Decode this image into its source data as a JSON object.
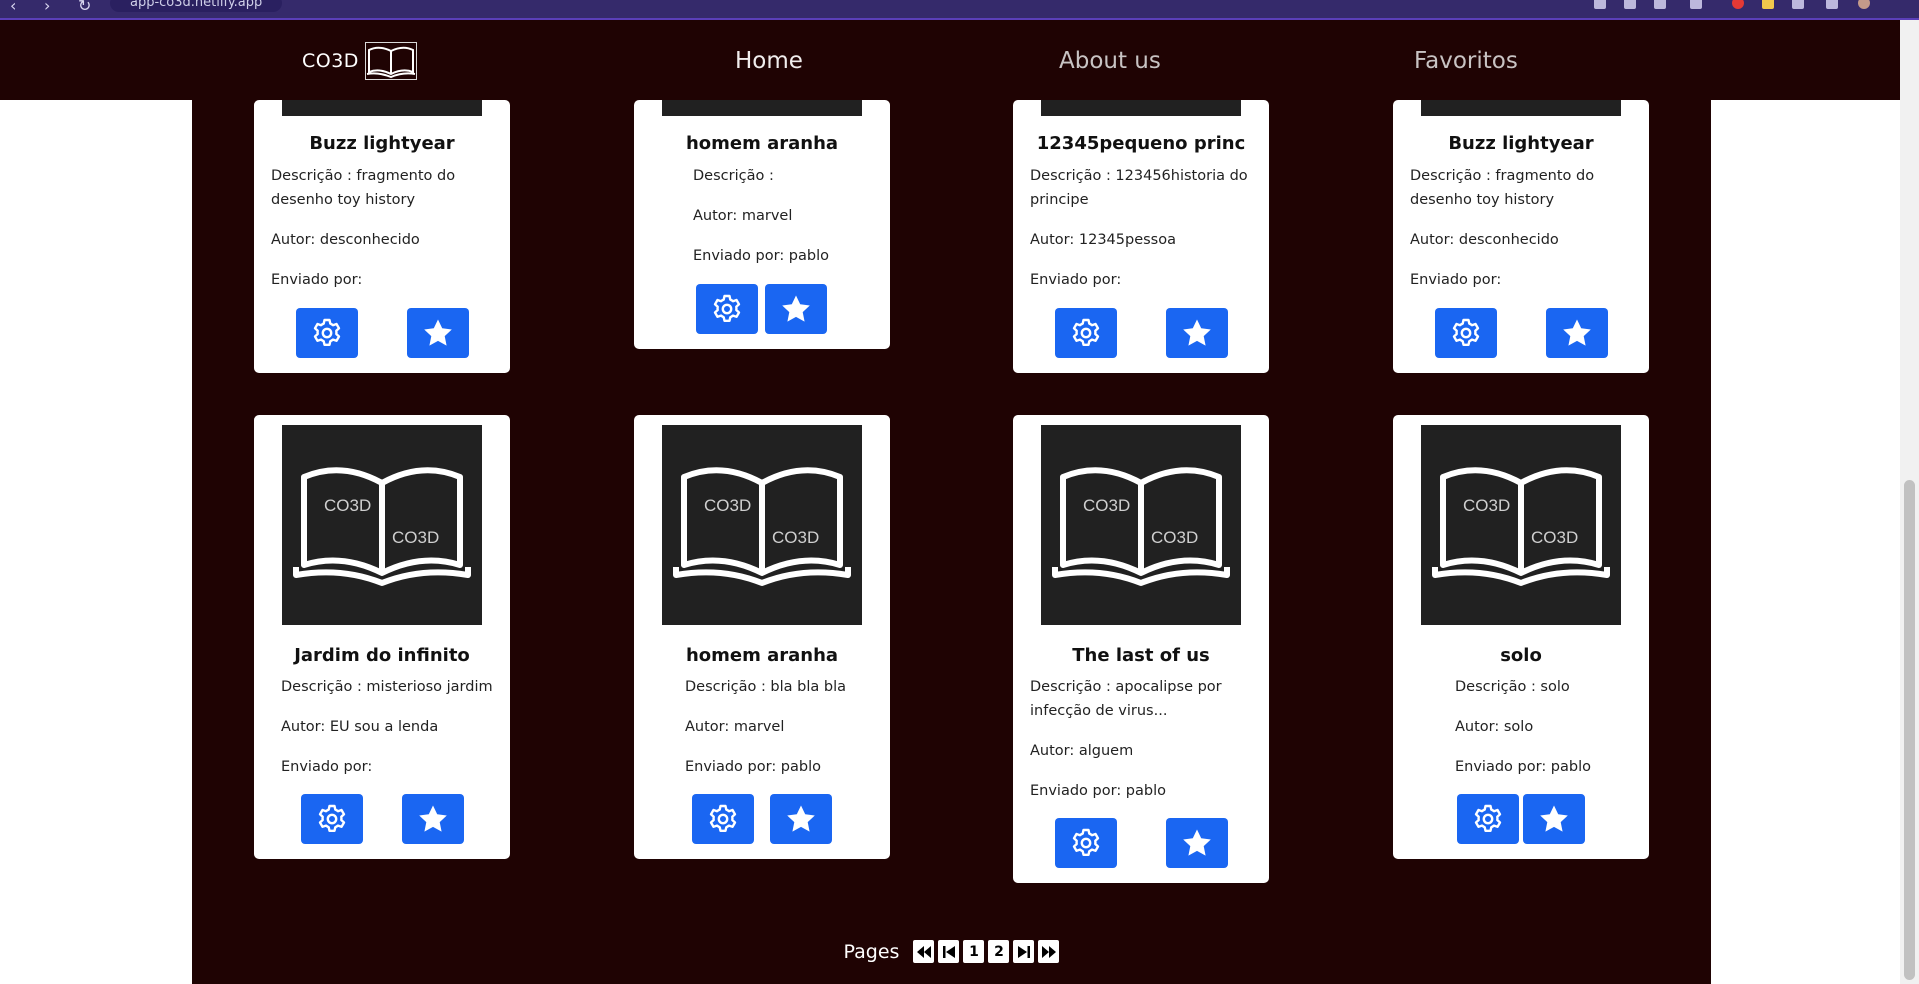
{
  "browser": {
    "url": "app-co3d.netlify.app"
  },
  "navbar": {
    "brand": "CO3D",
    "links": [
      "Home",
      "About us",
      "Favoritos"
    ]
  },
  "cover_text": "CO3D",
  "labels": {
    "description_prefix": "Descrição : ",
    "author_prefix": "Autor: ",
    "sent_by_prefix": "Enviado por: "
  },
  "cards": [
    {
      "title": "Buzz lightyear",
      "description_lines": [
        "Descrição : fragmento do",
        "desenho toy history"
      ],
      "author": "Autor: desconhecido",
      "sent_by": "Enviado por:"
    },
    {
      "title": "homem aranha",
      "description_lines": [
        "Descrição :"
      ],
      "author": "Autor: marvel",
      "sent_by": "Enviado por: pablo"
    },
    {
      "title": "12345pequeno princ",
      "description_lines": [
        "Descrição : 123456historia do",
        "principe"
      ],
      "author": "Autor: 12345pessoa",
      "sent_by": "Enviado por:"
    },
    {
      "title": "Buzz lightyear",
      "description_lines": [
        "Descrição : fragmento do",
        "desenho toy history"
      ],
      "author": "Autor: desconhecido",
      "sent_by": "Enviado por:"
    },
    {
      "title": "Jardim do infinito",
      "description_lines": [
        "Descrição : misterioso jardim"
      ],
      "author": "Autor: EU sou a lenda",
      "sent_by": "Enviado por:"
    },
    {
      "title": "homem aranha",
      "description_lines": [
        "Descrição : bla bla bla"
      ],
      "author": "Autor: marvel",
      "sent_by": "Enviado por: pablo"
    },
    {
      "title": "The last of us",
      "description_lines": [
        "Descrição : apocalipse por",
        "infecção de virus..."
      ],
      "author": "Autor: alguem",
      "sent_by": "Enviado por: pablo"
    },
    {
      "title": "solo",
      "description_lines": [
        "Descrição : solo"
      ],
      "author": "Autor: solo",
      "sent_by": "Enviado por: pablo"
    }
  ],
  "pagination": {
    "label": "Pages",
    "pages": [
      "1",
      "2"
    ]
  },
  "colors": {
    "navbar_bg": "#1f0303",
    "content_bg": "#1f0303",
    "button_blue": "#1a66f2",
    "cover_bg": "#212121"
  },
  "icons": {
    "settings": "gear-icon",
    "favorite": "star-icon",
    "first": "double-chevron-left-icon",
    "prev": "skip-back-icon",
    "next": "skip-forward-icon",
    "last": "double-chevron-right-icon"
  }
}
